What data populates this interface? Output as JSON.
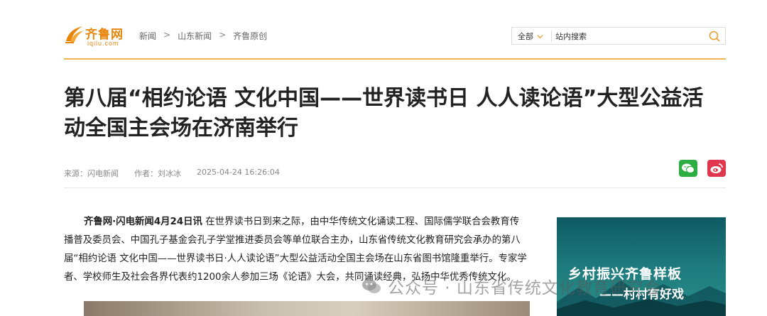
{
  "header": {
    "logo_text": "齐鲁网",
    "logo_sub": "iqilu.com",
    "breadcrumb": [
      "新闻",
      "山东新闻",
      "齐鲁原创"
    ],
    "breadcrumb_sep": ">",
    "search": {
      "scope": "全部",
      "placeholder": "站内搜索"
    }
  },
  "article": {
    "title": "第八届“相约论语 文化中国——世界读书日 人人读论语”大型公益活动全国主会场在济南举行",
    "source": "来源：闪电新闻",
    "author": "作者：刘冰冰",
    "datetime": "2025-04-24 16:26:04",
    "lead": "齐鲁网·闪电新闻4月24日讯",
    "body": " 在世界读书日到来之际，由中华传统文化诵读工程、国际儒学联合会教育传播普及委员会、中国孔子基金会孔子学堂推进委员会等单位联合主办，山东省传统文化教育研究会承办的第八届“相约论语 文化中国——世界读书日·人人读论语”大型公益活动全国主会场在山东省图书馆隆重举行。专家学者、学校师生及社会各界代表约1200余人参加三场《论语》大会，共同诵读经典，弘扬中华优秀传统文化。"
  },
  "banner": {
    "title": "乡村振兴齐鲁样板",
    "subtitle": "——村村有好戏"
  },
  "watermark": "公众号 · 山东省传统文化教育研究会",
  "colors": {
    "brand": "#e8860c",
    "rule": "#f2b455",
    "wechat": "#2dae42",
    "weibo": "#e0364e"
  },
  "icons": [
    "logo-mark-icon",
    "chevron-down-icon",
    "search-icon",
    "wechat-icon",
    "weibo-icon"
  ]
}
